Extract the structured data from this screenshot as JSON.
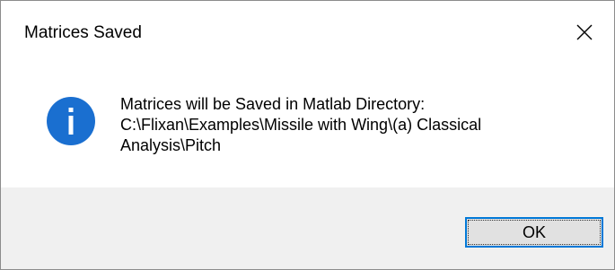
{
  "window": {
    "title": "Matrices Saved",
    "close_icon": "close-icon"
  },
  "message": {
    "icon": "info-icon",
    "icon_color": "#1a6fd0",
    "lines": [
      "Matrices will be Saved in Matlab Directory:",
      "C:\\Flixan\\Examples\\Missile with Wing\\(a) Classical",
      "Analysis\\Pitch"
    ]
  },
  "buttons": {
    "ok_label": "OK"
  },
  "colors": {
    "accent": "#0078d7",
    "footer_bg": "#f0f0f0",
    "button_bg": "#e1e1e1"
  }
}
